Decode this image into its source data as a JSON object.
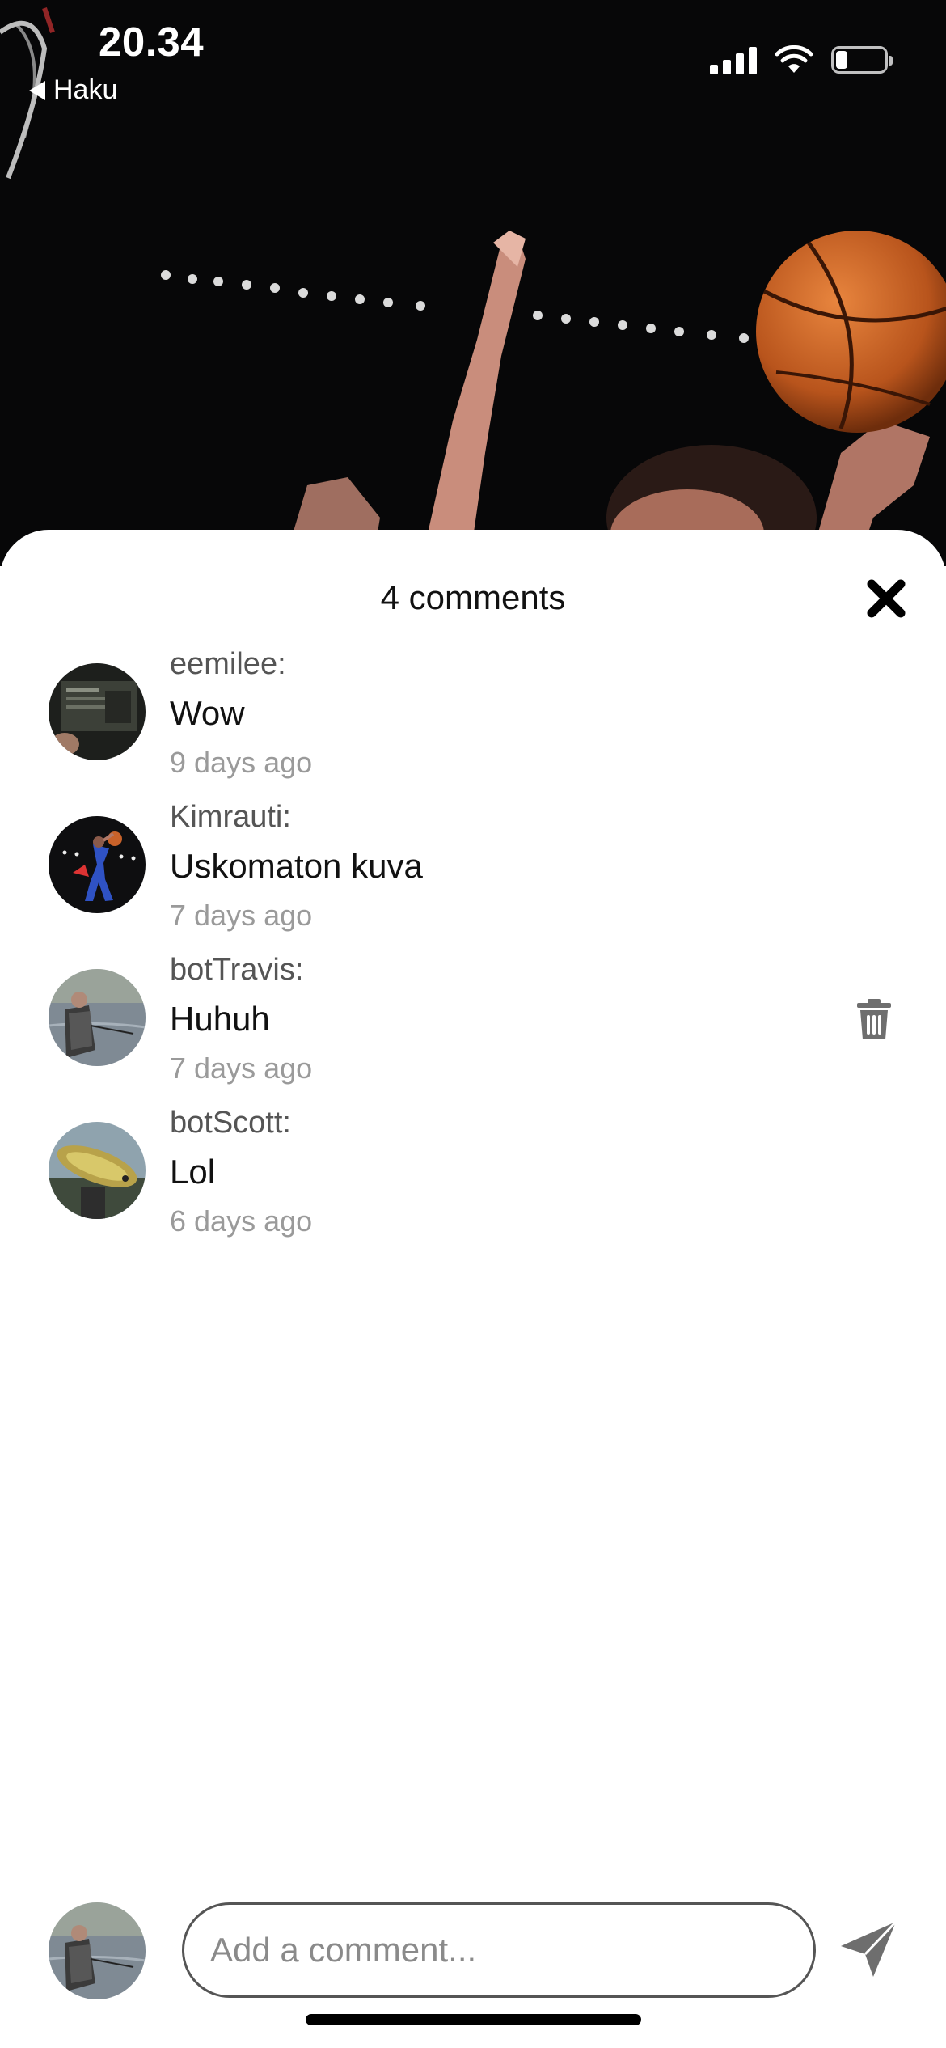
{
  "status_bar": {
    "time": "20.34",
    "back_label": "Haku"
  },
  "comments_panel": {
    "title": "4 comments",
    "comments": [
      {
        "author": "eemilee:",
        "text": "Wow",
        "time": "9 days ago",
        "can_delete": false
      },
      {
        "author": "Kimrauti:",
        "text": "Uskomaton kuva",
        "time": "7 days ago",
        "can_delete": false
      },
      {
        "author": "botTravis:",
        "text": "Huhuh",
        "time": "7 days ago",
        "can_delete": true
      },
      {
        "author": "botScott:",
        "text": "Lol",
        "time": "6 days ago",
        "can_delete": false
      }
    ]
  },
  "composer": {
    "placeholder": "Add a comment...",
    "value": ""
  },
  "icons": {
    "close": "close-icon",
    "delete": "trash-icon",
    "send": "send-icon",
    "back": "back-arrow-icon"
  },
  "colors": {
    "accent_dark": "#111111",
    "muted_text": "#9a9a9a",
    "icon_gray": "#6e6e6e"
  }
}
